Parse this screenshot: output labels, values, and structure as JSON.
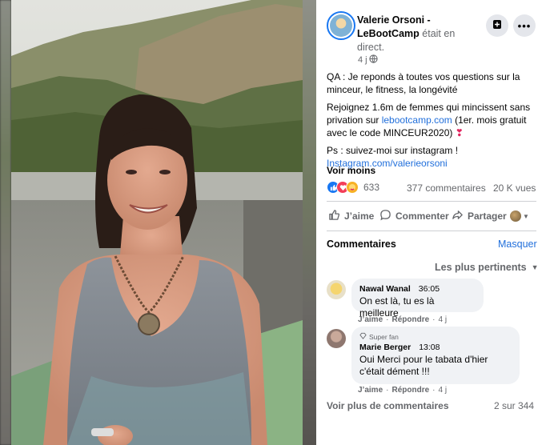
{
  "post": {
    "author_name_line1": "Valerie Orsoni -",
    "author_name_line2": "LeBootCamp",
    "author_status": "était en direct.",
    "author_status_line2": "direct.",
    "time": "4 j",
    "body_line1": "QA : Je reponds à toutes vos questions sur la minceur, le fitness, la longévité",
    "body_line2_pre": "Rejoignez 1.6m de femmes qui mincissent sans privation sur ",
    "body_line2_link": "lebootcamp.com",
    "body_line2_post": " (1er. mois gratuit avec le code MINCEUR2020) ",
    "body_line2_emoji": "❣",
    "ps_line": "Ps : suivez-moi sur instagram !",
    "instagram_link": "Instagram.com/valerieorsoni",
    "see_less": "Voir moins"
  },
  "stats": {
    "reactions_count": "633",
    "comments_count": "377 commentaires",
    "views_count": "20 K vues"
  },
  "actions": {
    "like": "J’aime",
    "comment": "Commenter",
    "share": "Partager"
  },
  "comments_section": {
    "title": "Commentaires",
    "hide": "Masquer",
    "sort": "Les plus pertinents",
    "items": [
      {
        "author": "Nawal Wanal",
        "time": "36:05",
        "text": "On est là, tu es là meilleure",
        "like": "J’aime",
        "reply": "Répondre",
        "age": "4 j"
      },
      {
        "badge": "Super fan",
        "author": "Marie Berger",
        "time": "13:08",
        "text": "Oui Merci pour le tabata d'hier c'était dément !!!",
        "like": "J’aime",
        "reply": "Répondre",
        "age": "4 j"
      }
    ],
    "more": "Voir plus de commentaires",
    "pagination": "2 sur 344"
  }
}
